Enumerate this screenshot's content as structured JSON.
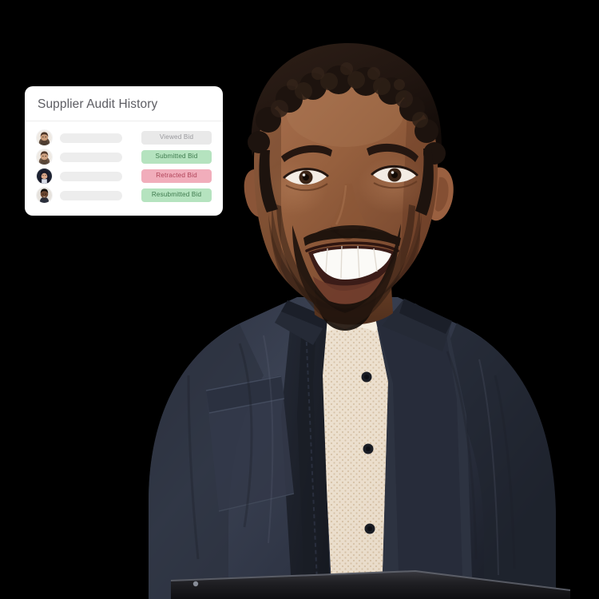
{
  "background_color": "#000000",
  "card": {
    "title": "Supplier Audit History",
    "title_color": "#5d5d63",
    "background_color": "#ffffff",
    "rows": [
      {
        "avatar_name": "avatar-bearded-man-light",
        "name_placeholder": "",
        "badge_label": "Viewed Bid",
        "badge_style": "neutral",
        "badge_bg": "#e9e9e9",
        "badge_text_color": "#9a9a9e"
      },
      {
        "avatar_name": "avatar-bearded-man-light-2",
        "name_placeholder": "",
        "badge_label": "Submitted Bid",
        "badge_style": "green",
        "badge_bg": "#b5e3bf",
        "badge_text_color": "#3f7b4e"
      },
      {
        "avatar_name": "avatar-dark-haired-woman",
        "name_placeholder": "",
        "badge_label": "Retracted Bid",
        "badge_style": "red",
        "badge_bg": "#f1adbb",
        "badge_text_color": "#b04358"
      },
      {
        "avatar_name": "avatar-dark-skinned-man",
        "name_placeholder": "",
        "badge_label": "Resubmitted Bid",
        "badge_style": "green",
        "badge_bg": "#b5e3bf",
        "badge_text_color": "#3f7b4e"
      }
    ]
  },
  "person": {
    "description": "Smiling man with short curly dark hair and beard, wearing an open dark navy button-up shirt over a cream knit top, holding a dark tablet at bottom",
    "skin_color": "#8d5a3f",
    "hair_color": "#241812",
    "shirt_color": "#343a4a",
    "undershirt_color": "#ede0cf",
    "tablet_color": "#1b1b1f"
  }
}
